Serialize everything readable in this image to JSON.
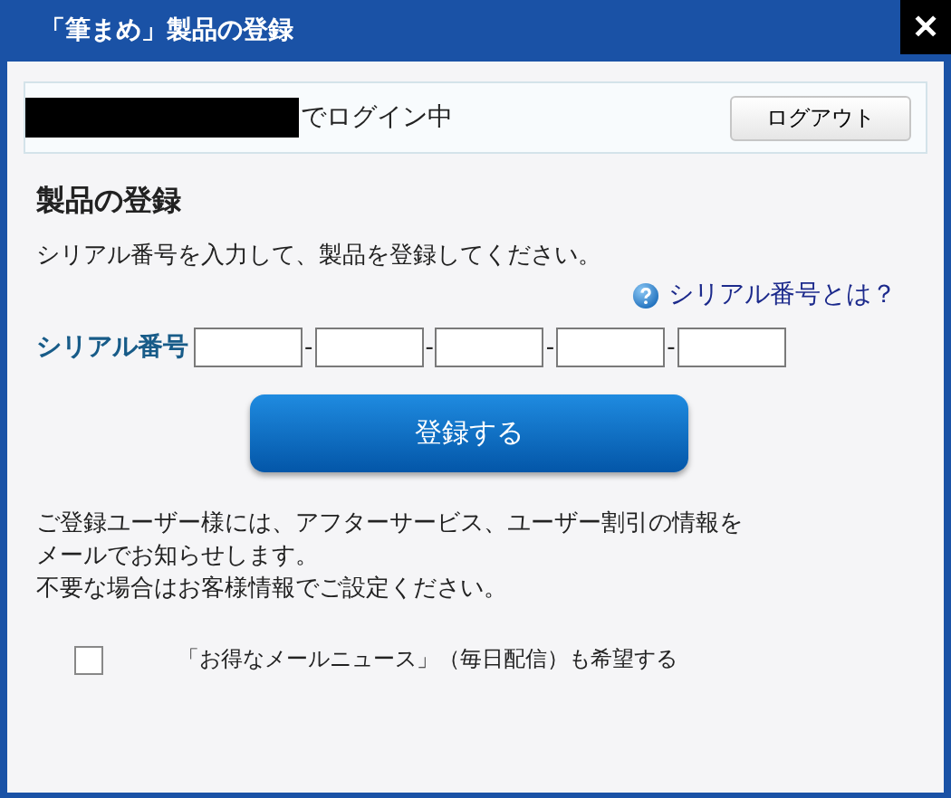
{
  "window": {
    "title": "「筆まめ」製品の登録",
    "close": "✕"
  },
  "login_bar": {
    "redacted": true,
    "status": "でログイン中",
    "logout_button": "ログアウト"
  },
  "heading": "製品の登録",
  "instruction": "シリアル番号を入力して、製品を登録してください。",
  "help_link": "シリアル番号とは？",
  "serial": {
    "label": "シリアル番号",
    "separator": "-",
    "fields": [
      {
        "kind": "text"
      },
      {
        "kind": "text"
      },
      {
        "kind": "text"
      },
      {
        "kind": "text"
      },
      {
        "kind": "text"
      }
    ]
  },
  "register_button": "登録する",
  "notice_lines": [
    "ご登録ユーザー様には、アフターサービス、ユーザー割引の情報を",
    "メールでお知らせします。",
    "不要な場合はお客様情報でご設定ください。"
  ],
  "newsletter": {
    "checked": false,
    "label": "「お得なメールニュース」（毎日配信）も希望する"
  }
}
